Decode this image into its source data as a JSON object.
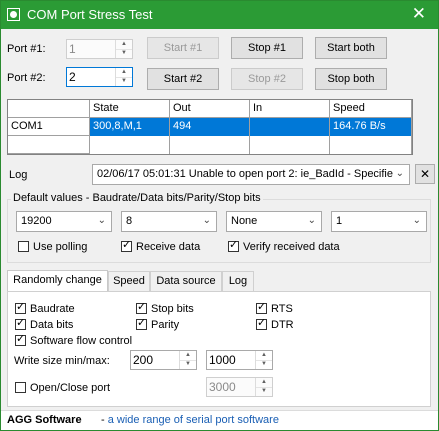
{
  "window": {
    "title": "COM Port Stress Test",
    "close_label": "✕",
    "accent": "#2b9b35"
  },
  "ports": {
    "port1_label": "Port #1:",
    "port1_value": "1",
    "port2_label": "Port #2:",
    "port2_value": "2",
    "start1_label": "Start #1",
    "stop1_label": "Stop #1",
    "startboth1_label": "Start both",
    "start2_label": "Start #2",
    "stop2_label": "Stop #2",
    "stopboth2_label": "Stop both"
  },
  "grid": {
    "columns": [
      "State",
      "Out",
      "In",
      "Speed"
    ],
    "rows": [
      {
        "name": "COM1",
        "state": "300,8,M,1",
        "out": "494",
        "in": "",
        "speed": "164.76 B/s"
      }
    ]
  },
  "log": {
    "label": "Log",
    "value": "02/06/17 05:01:31 Unable to open port 2: ie_BadId - Specifie",
    "clear_label": "✕"
  },
  "defaults": {
    "legend": "Default values - Baudrate/Data bits/Parity/Stop bits",
    "baudrate": "19200",
    "databits": "8",
    "parity": "None",
    "stopbits": "1",
    "use_polling": "Use polling",
    "receive_data": "Receive data",
    "verify_data": "Verify received data"
  },
  "tabs": [
    "Randomly change",
    "Speed",
    "Data source",
    "Log"
  ],
  "random": {
    "baudrate": "Baudrate",
    "databits": "Data bits",
    "flow": "Software flow control",
    "stopbits": "Stop bits",
    "parity": "Parity",
    "rts": "RTS",
    "dtr": "DTR",
    "write_size_label": "Write size min/max:",
    "write_min": "200",
    "write_max": "1000",
    "open_close": "Open/Close port",
    "open_close_value": "3000"
  },
  "footer": {
    "brand": "AGG Software",
    "dash": " - ",
    "tagline": "a wide range of serial port software"
  },
  "check_mark": "✓"
}
